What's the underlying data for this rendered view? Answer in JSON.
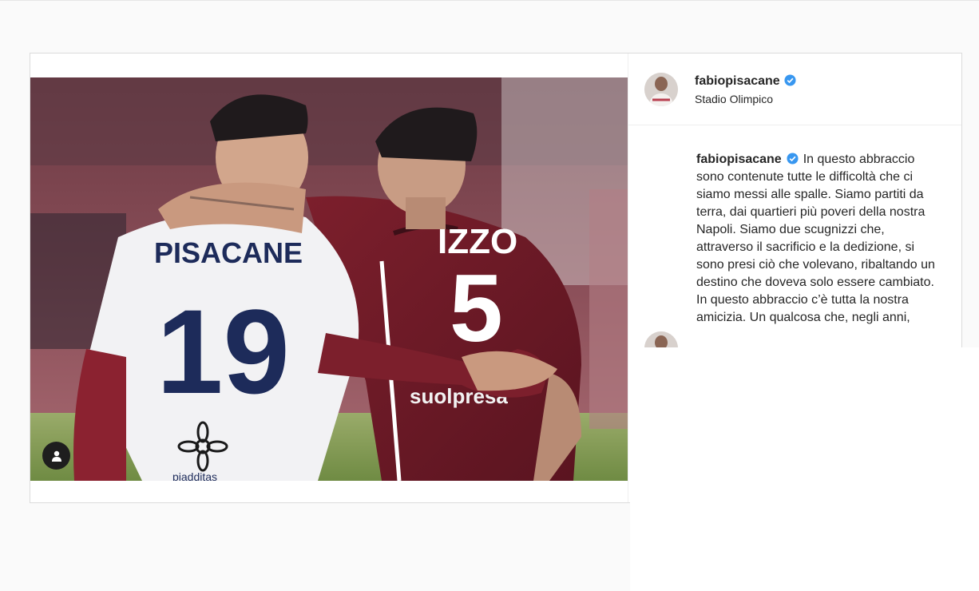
{
  "post": {
    "username": "fabiopisacane",
    "location": "Stadio Olimpico",
    "caption_username": "fabiopisacane",
    "caption_text": "In questo abbraccio sono contenute tutte le difficoltà che ci siamo messi alle spalle. Siamo partiti da terra, dai quartieri più poveri della nostra Napoli. Siamo due scugnizzi che, attraverso il sacrificio e la dedizione, si sono presi ciò che volevano, ribaltando un destino che doveva solo essere cambiato.\nIn questo abbraccio c’è tutta la nostra amicizia. Un qualcosa che, negli anni,",
    "verified_color": "#3897f0"
  },
  "photo": {
    "left_player_name": "PISACANE",
    "left_player_number": "19",
    "right_player_name": "IZZO",
    "right_player_number": "5",
    "sponsor_text": "suolpresa",
    "sponsor_text_2": "piadditas"
  },
  "icons": {
    "tag": "user-tag-icon",
    "verified": "verified-badge-icon"
  }
}
